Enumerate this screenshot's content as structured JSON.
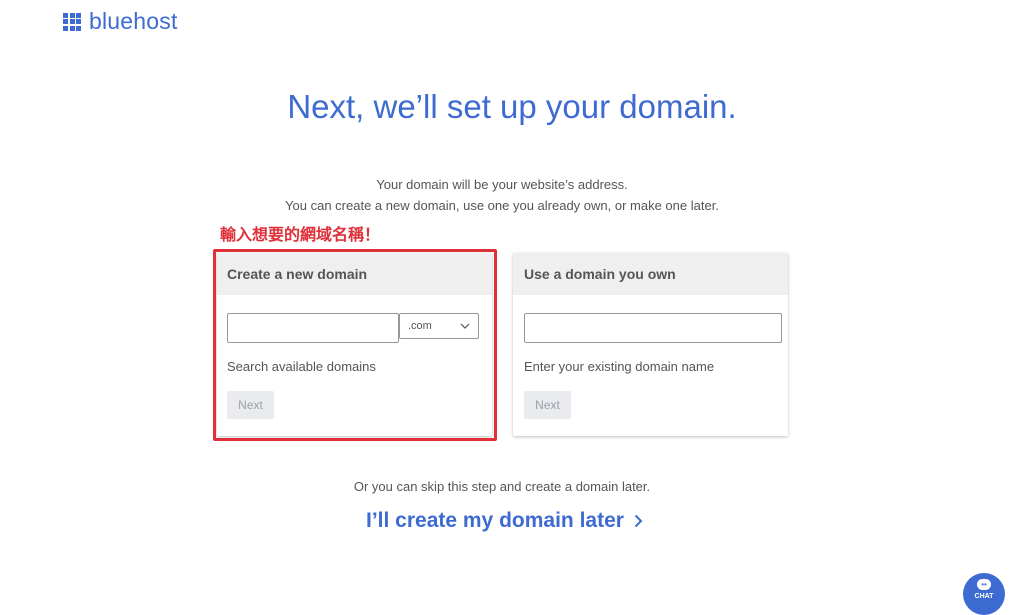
{
  "brand": {
    "name": "bluehost"
  },
  "headline": "Next, we’ll set up your domain.",
  "subtext": {
    "line1": "Your domain will be your website’s address.",
    "line2": "You can create a new domain, use one you already own, or make one later."
  },
  "annotation": "輸入想要的網域名稱！",
  "new_domain_card": {
    "title": "Create a new domain",
    "domain_input_value": "",
    "tld_selected": ".com",
    "hint": "Search available domains",
    "next_label": "Next"
  },
  "own_domain_card": {
    "title": "Use a domain you own",
    "domain_input_value": "",
    "hint": "Enter your existing domain name",
    "next_label": "Next"
  },
  "skip": {
    "text": "Or you can skip this step and create a domain later.",
    "link_label": "I’ll create my domain later"
  },
  "chat": {
    "label": "CHAT"
  },
  "colors": {
    "brand_blue": "#3e6bd1",
    "annotation_red": "#e0303a"
  }
}
